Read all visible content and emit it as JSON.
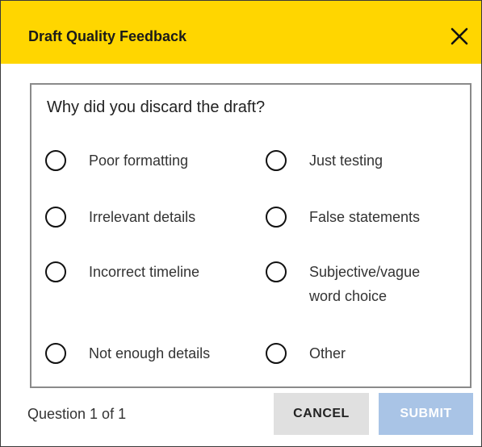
{
  "dialog": {
    "title": "Draft Quality Feedback",
    "close_icon": "close-icon",
    "accent_color": "#ffd600"
  },
  "question": {
    "text": "Why did you discard the draft?",
    "options": [
      {
        "label": "Poor formatting",
        "selected": false
      },
      {
        "label": "Just testing",
        "selected": false
      },
      {
        "label": "Irrelevant details",
        "selected": false
      },
      {
        "label": "False statements",
        "selected": false
      },
      {
        "label": "Incorrect timeline",
        "selected": false
      },
      {
        "label": "Subjective/vague word choice",
        "selected": false
      },
      {
        "label": "Not enough details",
        "selected": false
      },
      {
        "label": "Other",
        "selected": false
      }
    ]
  },
  "footer": {
    "status": "Question 1 of 1",
    "cancel_label": "CANCEL",
    "submit_label": "SUBMIT",
    "submit_disabled": true
  }
}
